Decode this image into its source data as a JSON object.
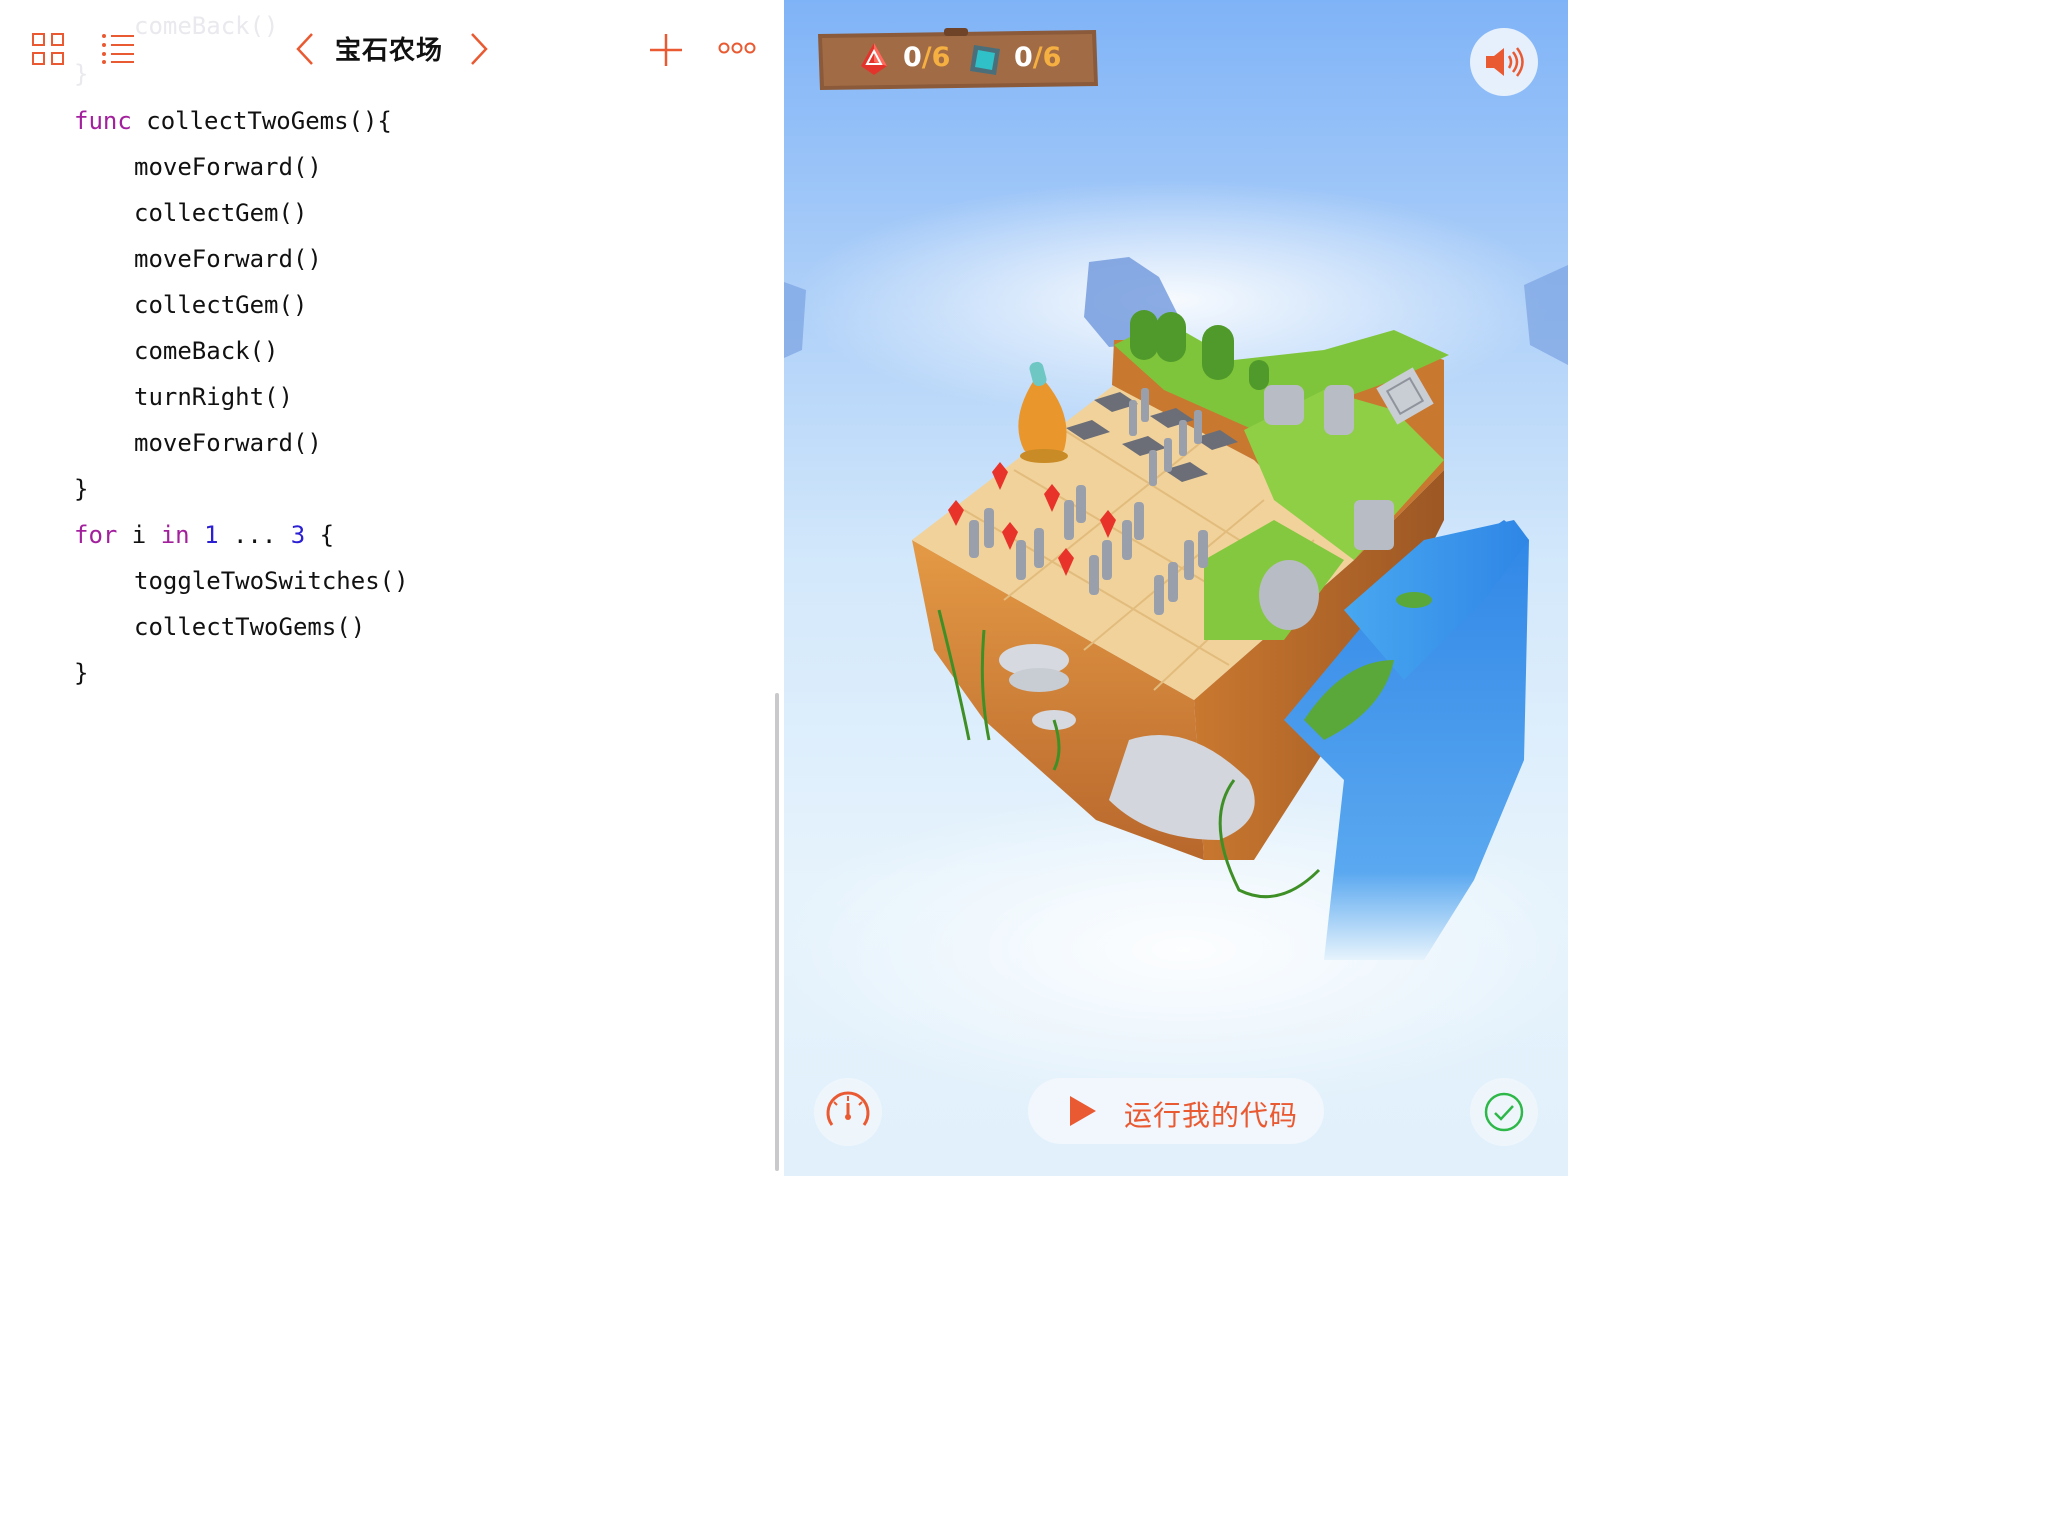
{
  "editor": {
    "ghost_line": "comeBack()",
    "ghost_brace": "}",
    "title": "宝石农场",
    "code": {
      "l1_kw": "func",
      "l1_rest": " collectTwoGems(){",
      "l2": "moveForward()",
      "l3": "collectGem()",
      "l4": "moveForward()",
      "l5": "collectGem()",
      "l6": "comeBack()",
      "l7": "turnRight()",
      "l8": "moveForward()",
      "l9": "}",
      "l10_for": "for",
      "l10_i": " i ",
      "l10_in": "in",
      "l10_sp": " ",
      "l10_start": "1",
      "l10_range": " ... ",
      "l10_end": "3",
      "l10_brace": " {",
      "l11": "toggleTwoSwitches()",
      "l12": "collectTwoGems()",
      "l13": "}"
    },
    "accent_color": "#ea5a32"
  },
  "scene": {
    "gems": {
      "collected": "0",
      "total": "/6"
    },
    "switches": {
      "collected": "0",
      "total": "/6"
    },
    "run_button_label": "运行我的代码",
    "icons": {
      "grid": "grid-icon",
      "outline": "list-icon",
      "prev": "chevron-left-icon",
      "next": "chevron-right-icon",
      "add": "plus-icon",
      "more": "more-icon",
      "sound": "speaker-icon",
      "speed": "speedometer-icon",
      "check": "checkmark-icon",
      "play": "play-icon"
    }
  }
}
